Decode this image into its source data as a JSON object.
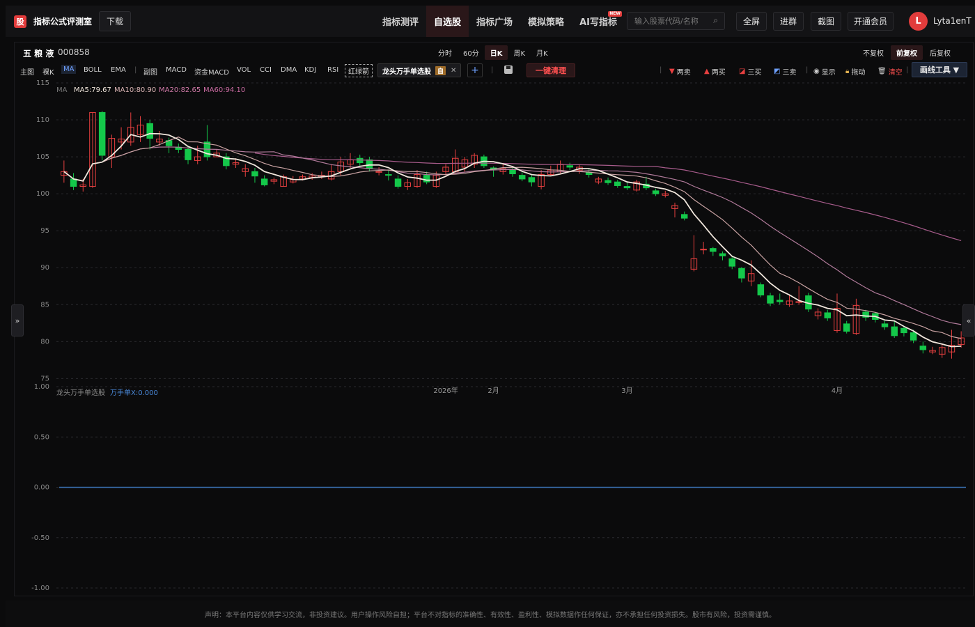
{
  "app": {
    "logo_char": "股",
    "title": "指标公式评测室",
    "download": "下载"
  },
  "nav": [
    {
      "label": "指标测评",
      "active": false
    },
    {
      "label": "自选股",
      "active": true
    },
    {
      "label": "指标广场",
      "active": false
    },
    {
      "label": "模拟策略",
      "active": false
    },
    {
      "label": "AI写指标",
      "active": false,
      "badge": "NEW"
    }
  ],
  "search": {
    "placeholder": "输入股票代码/名称",
    "icon": "search-icon"
  },
  "header_buttons": [
    "全屏",
    "进群",
    "截图",
    "开通会员"
  ],
  "user": {
    "avatar_letter": "L",
    "name": "Lyta1enT"
  },
  "stock": {
    "name": "五 粮 液",
    "code": "000858"
  },
  "periods": [
    {
      "label": "分时",
      "active": false
    },
    {
      "label": "60分",
      "active": false
    },
    {
      "label": "日K",
      "active": true
    },
    {
      "label": "周K",
      "active": false
    },
    {
      "label": "月K",
      "active": false
    }
  ],
  "adjust": [
    {
      "label": "不复权",
      "active": false
    },
    {
      "label": "前复权",
      "active": true
    },
    {
      "label": "后复权",
      "active": false
    }
  ],
  "toolbar": {
    "main_items": [
      "主图",
      "裸K",
      "MA",
      "BOLL",
      "EMA"
    ],
    "active_main": "MA",
    "sub_label": "副图",
    "sub_items": [
      "MACD",
      "资金MACD",
      "VOL",
      "CCI",
      "DMA",
      "KDJ",
      "RSI"
    ],
    "red_green_arrow": "红绿箭",
    "indicator_chip": "龙头万手单选股",
    "indicator_tag": "自",
    "clear_button": "一键清理",
    "drawing": [
      "两卖",
      "两买",
      "三买",
      "三卖",
      "显示",
      "拖动",
      "清空"
    ],
    "draw_tool": "画线工具 ▼"
  },
  "ma_legend": {
    "label": "MA",
    "ma5": "MA5:79.67",
    "ma10": "MA10:80.90",
    "ma20": "MA20:82.65",
    "ma60": "MA60:94.10"
  },
  "sub_legend": {
    "name": "龙头万手单选股",
    "value": "万手单X:0.000"
  },
  "colors": {
    "up": "#e84040",
    "down": "#14c84a",
    "ma5": "#f0e6dc",
    "ma10": "#c8a2a2",
    "ma20": "#b07a9a",
    "ma60": "#a85c8c",
    "sub_line": "#3a6fb0",
    "accent": "#e23c3c"
  },
  "chart_data": {
    "type": "candlestick",
    "main_yticks": [
      115,
      110,
      105,
      100,
      95,
      90,
      85,
      80,
      75
    ],
    "main_ylim": [
      74,
      115
    ],
    "sub_yticks": [
      "1.00",
      "0.50",
      "0.00",
      "-0.50",
      "-1.00"
    ],
    "sub_ylim": [
      -1,
      1
    ],
    "x_labels": [
      {
        "label": "2026年",
        "index": 40
      },
      {
        "label": "2月",
        "index": 45
      },
      {
        "label": "3月",
        "index": 59
      },
      {
        "label": "4月",
        "index": 81
      }
    ],
    "candles": [
      [
        102.5,
        103.0,
        104.5,
        101.5
      ],
      [
        102.0,
        101.0,
        102.8,
        100.5
      ],
      [
        101.0,
        101.2,
        102.0,
        100.3
      ],
      [
        101.0,
        111.0,
        111.0,
        100.8
      ],
      [
        111.0,
        105.2,
        111.2,
        104.5
      ],
      [
        105.0,
        107.5,
        108.0,
        103.5
      ],
      [
        107.0,
        107.4,
        109.0,
        106.0
      ],
      [
        107.0,
        109.0,
        111.0,
        106.5
      ],
      [
        108.0,
        109.3,
        110.5,
        107.0
      ],
      [
        109.5,
        107.5,
        110.0,
        106.0
      ],
      [
        107.0,
        107.4,
        108.5,
        106.5
      ],
      [
        107.2,
        106.5,
        107.6,
        105.5
      ],
      [
        106.3,
        106.0,
        106.8,
        105.5
      ],
      [
        106.0,
        104.6,
        106.5,
        104.0
      ],
      [
        104.5,
        105.0,
        106.5,
        104.0
      ],
      [
        107.0,
        105.0,
        109.3,
        104.5
      ],
      [
        105.0,
        105.5,
        106.0,
        105.0
      ],
      [
        105.0,
        103.8,
        105.5,
        103.3
      ],
      [
        104.0,
        104.2,
        104.8,
        103.5
      ],
      [
        103.0,
        103.4,
        104.0,
        102.3
      ],
      [
        103.0,
        102.4,
        103.5,
        101.5
      ],
      [
        102.0,
        101.2,
        102.5,
        101.0
      ],
      [
        101.7,
        101.9,
        102.2,
        101.3
      ],
      [
        101.0,
        102.3,
        102.6,
        101.0
      ],
      [
        101.6,
        101.9,
        102.4,
        101.4
      ],
      [
        102.0,
        102.3,
        102.6,
        101.8
      ],
      [
        102.2,
        102.4,
        102.8,
        101.9
      ],
      [
        102.3,
        102.5,
        103.0,
        102.0
      ],
      [
        102.0,
        103.0,
        104.0,
        101.8
      ],
      [
        103.0,
        104.3,
        105.0,
        102.5
      ],
      [
        104.0,
        104.6,
        105.5,
        103.5
      ],
      [
        104.8,
        104.2,
        105.3,
        103.8
      ],
      [
        104.6,
        103.4,
        105.0,
        103.0
      ],
      [
        103.0,
        103.0,
        103.6,
        102.5
      ],
      [
        102.6,
        102.5,
        103.2,
        101.8
      ],
      [
        102.0,
        101.0,
        102.5,
        100.7
      ],
      [
        101.0,
        101.5,
        102.0,
        100.5
      ],
      [
        101.0,
        102.6,
        103.2,
        100.8
      ],
      [
        102.5,
        101.6,
        103.0,
        101.3
      ],
      [
        101.0,
        102.5,
        103.0,
        100.8
      ],
      [
        103.0,
        103.6,
        104.0,
        102.5
      ],
      [
        103.0,
        104.8,
        106.0,
        102.8
      ],
      [
        103.6,
        104.6,
        105.0,
        103.0
      ],
      [
        104.0,
        105.2,
        105.5,
        103.5
      ],
      [
        105.0,
        103.8,
        105.3,
        103.5
      ],
      [
        103.5,
        103.3,
        103.7,
        102.3
      ],
      [
        103.0,
        103.4,
        104.0,
        102.6
      ],
      [
        103.3,
        102.7,
        103.6,
        102.3
      ],
      [
        102.5,
        102.0,
        102.9,
        101.7
      ],
      [
        102.2,
        101.6,
        102.5,
        101.0
      ],
      [
        101.0,
        102.6,
        103.2,
        100.6
      ],
      [
        102.6,
        103.2,
        103.8,
        102.4
      ],
      [
        103.0,
        104.0,
        104.5,
        102.8
      ],
      [
        103.8,
        103.6,
        104.2,
        103.2
      ],
      [
        103.2,
        103.6,
        104.0,
        102.7
      ],
      [
        102.9,
        102.6,
        103.3,
        102.2
      ],
      [
        101.6,
        102.0,
        102.3,
        101.3
      ],
      [
        101.8,
        101.5,
        102.2,
        101.2
      ],
      [
        101.6,
        101.1,
        101.9,
        100.8
      ],
      [
        101.0,
        100.8,
        101.5,
        100.5
      ],
      [
        100.5,
        101.6,
        101.9,
        100.3
      ],
      [
        101.3,
        100.8,
        102.3,
        100.5
      ],
      [
        100.4,
        100.0,
        100.7,
        99.7
      ],
      [
        99.8,
        100.0,
        100.4,
        99.5
      ],
      [
        98.0,
        98.4,
        98.8,
        96.8
      ],
      [
        97.2,
        96.7,
        97.6,
        96.4
      ],
      [
        89.8,
        91.2,
        94.4,
        89.5
      ],
      [
        92.5,
        92.5,
        93.5,
        91.8
      ],
      [
        92.6,
        92.2,
        92.8,
        91.6
      ],
      [
        91.9,
        91.6,
        92.2,
        91.0
      ],
      [
        91.2,
        90.2,
        91.6,
        89.8
      ],
      [
        89.9,
        88.6,
        90.1,
        88.0
      ],
      [
        88.2,
        89.2,
        91.0,
        87.5
      ],
      [
        87.7,
        86.3,
        88.0,
        86.0
      ],
      [
        86.2,
        85.2,
        86.6,
        84.8
      ],
      [
        85.6,
        85.4,
        86.5,
        85.0
      ],
      [
        85.0,
        85.5,
        86.3,
        84.7
      ],
      [
        85.3,
        85.4,
        87.5,
        85.0
      ],
      [
        86.2,
        84.4,
        86.6,
        84.0
      ],
      [
        83.5,
        84.0,
        84.5,
        83.0
      ],
      [
        83.9,
        83.2,
        84.3,
        82.8
      ],
      [
        81.5,
        84.5,
        86.5,
        81.2
      ],
      [
        82.4,
        81.4,
        82.8,
        81.1
      ],
      [
        81.1,
        84.9,
        85.8,
        80.9
      ],
      [
        84.0,
        83.3,
        84.3,
        82.8
      ],
      [
        83.8,
        83.0,
        84.0,
        82.6
      ],
      [
        82.4,
        82.0,
        82.8,
        81.6
      ],
      [
        82.0,
        80.8,
        82.8,
        80.5
      ],
      [
        81.8,
        81.2,
        82.0,
        80.7
      ],
      [
        81.2,
        80.2,
        81.6,
        79.8
      ],
      [
        79.4,
        78.9,
        80.0,
        78.4
      ],
      [
        78.6,
        78.8,
        79.3,
        78.3
      ],
      [
        78.3,
        79.2,
        79.6,
        77.8
      ],
      [
        78.6,
        79.5,
        81.6,
        77.7
      ],
      [
        79.6,
        80.5,
        81.4,
        79.2
      ]
    ]
  },
  "disclaimer": "声明：本平台内容仅供学习交流，非投资建议。用户操作风险自担；平台不对指标的准确性、有效性、盈利性、模拟数据作任何保证，亦不承担任何投资损失。股市有风险，投资需谨慎。"
}
